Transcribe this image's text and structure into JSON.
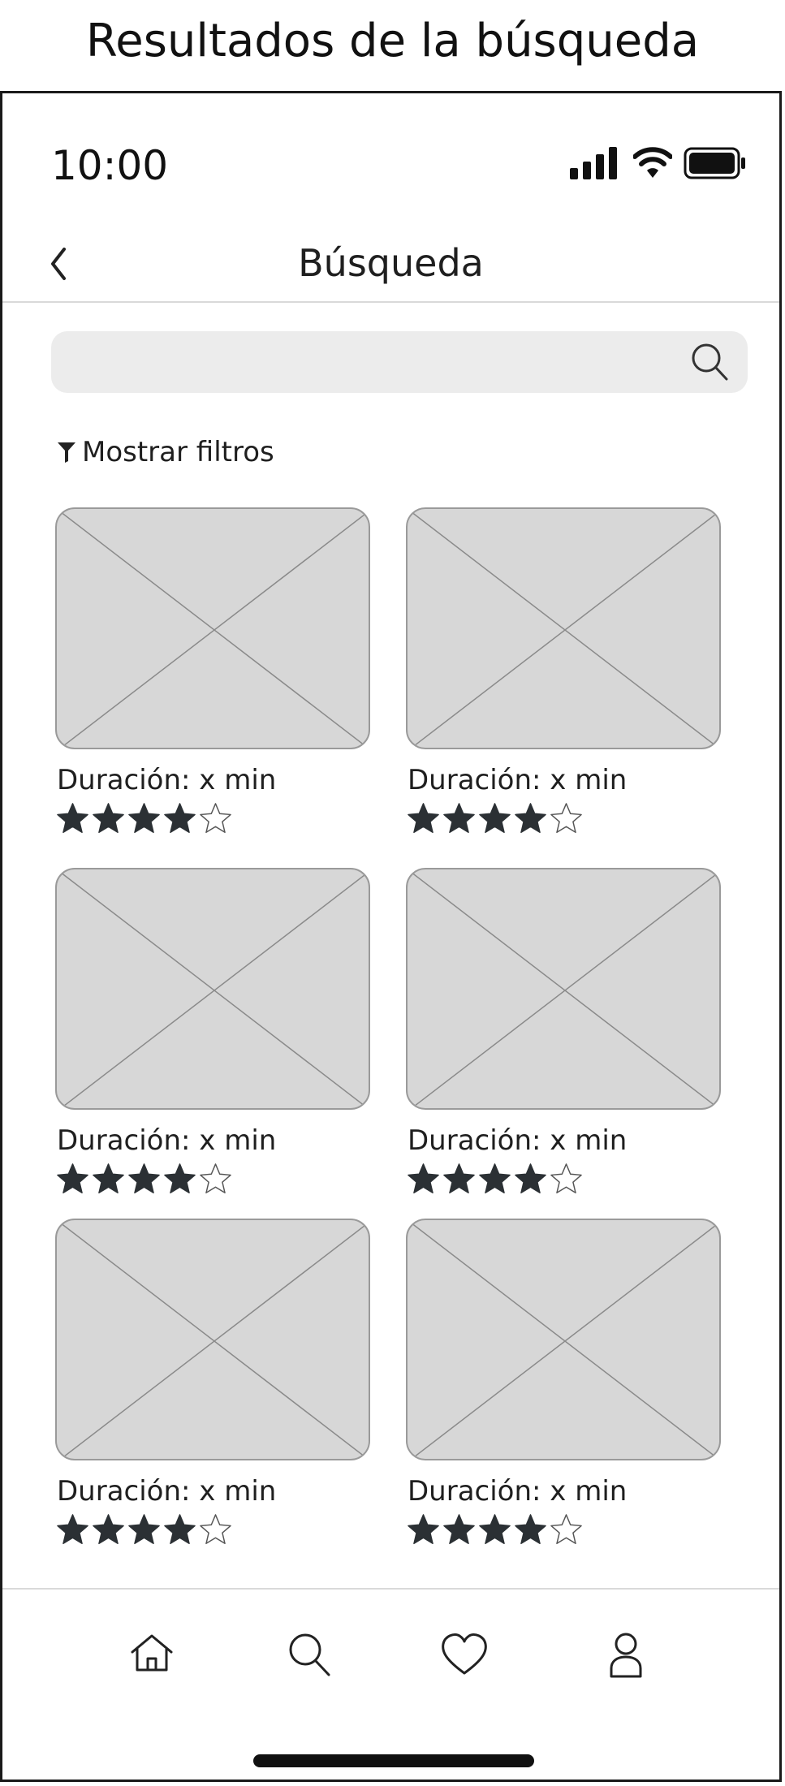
{
  "caption": "Resultados de la búsqueda",
  "status_bar": {
    "time": "10:00",
    "icons": [
      "signal-icon",
      "wifi-icon",
      "battery-icon"
    ]
  },
  "header": {
    "title": "Búsqueda",
    "back_icon": "chevron-left-icon"
  },
  "search": {
    "value": "",
    "placeholder": "",
    "icon": "search-icon"
  },
  "filters": {
    "label": "Mostrar filtros",
    "icon": "filter-icon"
  },
  "results": [
    {
      "duration": "Duración: x min",
      "rating": 4,
      "max_rating": 5
    },
    {
      "duration": "Duración: x min",
      "rating": 4,
      "max_rating": 5
    },
    {
      "duration": "Duración: x min",
      "rating": 4,
      "max_rating": 5
    },
    {
      "duration": "Duración: x min",
      "rating": 4,
      "max_rating": 5
    },
    {
      "duration": "Duración: x min",
      "rating": 4,
      "max_rating": 5
    },
    {
      "duration": "Duración: x min",
      "rating": 4,
      "max_rating": 5
    }
  ],
  "tab_bar": {
    "tabs": [
      "home-icon",
      "search-icon",
      "heart-icon",
      "user-icon"
    ]
  },
  "colors": {
    "star_fill": "#2b3034",
    "placeholder_bg": "#d7d7d7",
    "search_bg": "#ececec"
  }
}
